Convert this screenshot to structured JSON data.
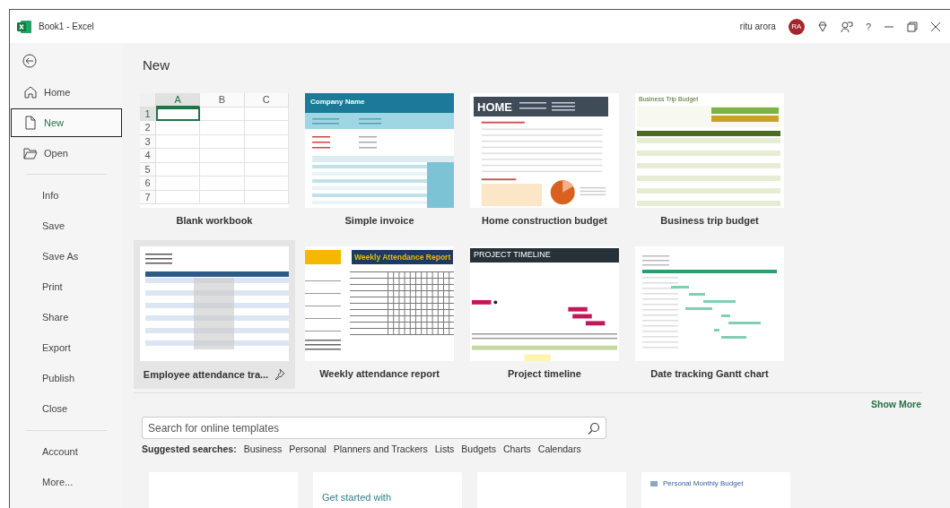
{
  "title_bar": {
    "title": "Book1  -  Excel",
    "user_name": "ritu arora",
    "avatar_initials": "RA",
    "help": "?"
  },
  "sidebar": {
    "groups": [
      [
        {
          "label": "Home",
          "kind": "home",
          "selected": false
        },
        {
          "label": "New",
          "kind": "new",
          "selected": true
        },
        {
          "label": "Open",
          "kind": "open",
          "selected": false
        }
      ],
      [
        {
          "label": "Info",
          "kind": "plain",
          "selected": false
        },
        {
          "label": "Save",
          "kind": "plain",
          "selected": false
        },
        {
          "label": "Save As",
          "kind": "plain",
          "selected": false
        },
        {
          "label": "Print",
          "kind": "plain",
          "selected": false
        },
        {
          "label": "Share",
          "kind": "plain",
          "selected": false
        },
        {
          "label": "Export",
          "kind": "plain",
          "selected": false
        },
        {
          "label": "Publish",
          "kind": "plain",
          "selected": false
        },
        {
          "label": "Close",
          "kind": "plain",
          "selected": false
        }
      ],
      [
        {
          "label": "Account",
          "kind": "plain",
          "selected": false
        },
        {
          "label": "More...",
          "kind": "plain",
          "selected": false
        }
      ]
    ]
  },
  "page_title": "New",
  "templates": [
    {
      "kind": "blank",
      "label": "Blank workbook",
      "hovered": false,
      "columns": [
        "A",
        "B",
        "C"
      ],
      "rows": [
        "1",
        "2",
        "3",
        "4",
        "5",
        "6",
        "7"
      ]
    },
    {
      "kind": "invoice",
      "label": "Simple invoice",
      "hovered": false,
      "heading": "Company Name"
    },
    {
      "kind": "construction",
      "label": "Home construction budget",
      "hovered": false,
      "heading": "HOME"
    },
    {
      "kind": "trip",
      "label": "Business trip budget",
      "hovered": false,
      "heading": "Business Trip Budget"
    },
    {
      "kind": "attendance",
      "label": "Employee attendance tra...",
      "hovered": true
    },
    {
      "kind": "weekly",
      "label": "Weekly attendance report",
      "hovered": false,
      "heading": "Weekly Attendance Report"
    },
    {
      "kind": "timeline",
      "label": "Project timeline",
      "hovered": false,
      "heading": "PROJECT TIMELINE"
    },
    {
      "kind": "gantt",
      "label": "Date tracking Gantt chart",
      "hovered": false
    }
  ],
  "show_more": "Show More",
  "search": {
    "placeholder": "Search for online templates"
  },
  "suggested": {
    "label": "Suggested searches:",
    "items": [
      "Business",
      "Personal",
      "Planners and Trackers",
      "Lists",
      "Budgets",
      "Charts",
      "Calendars"
    ]
  },
  "more_templates": [
    {
      "kind": "empty"
    },
    {
      "kind": "intro",
      "heading": "Get started with"
    },
    {
      "kind": "empty"
    },
    {
      "kind": "budget",
      "heading": "Personal Monthly Budget"
    }
  ]
}
